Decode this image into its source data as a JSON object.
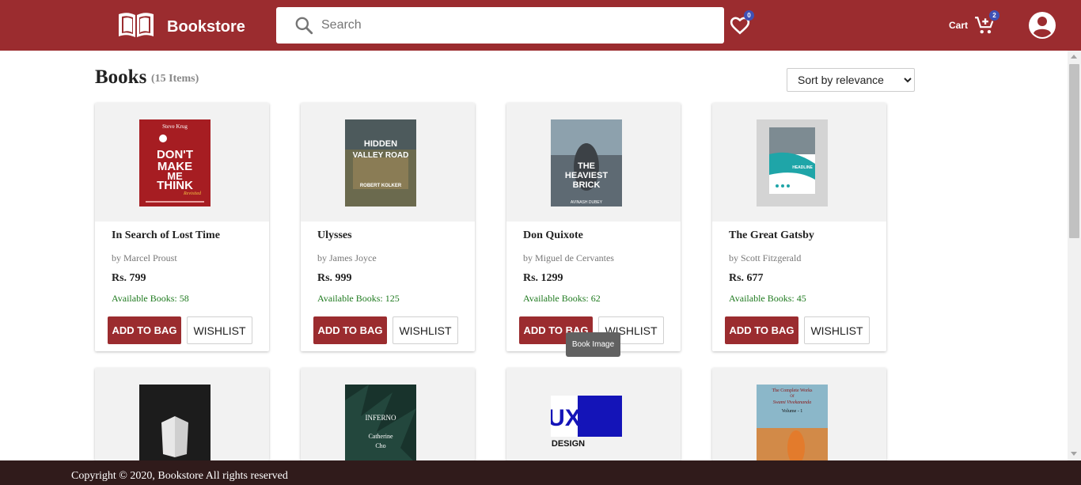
{
  "header": {
    "brand": "Bookstore",
    "search_placeholder": "Search",
    "wishlist_count": "0",
    "cart_label": "Cart",
    "cart_count": "2",
    "colors": {
      "primary": "#9b2c2f",
      "badge": "#3f51b5"
    }
  },
  "main": {
    "title": "Books",
    "count": "(15  Items)",
    "sort": {
      "selected": "Sort by relevance"
    }
  },
  "books": [
    {
      "title": "In Search of Lost Time",
      "author": "by Marcel Proust",
      "price": "Rs. 799",
      "available": "Available Books: 58",
      "cover": "book-cover-dont-make-me-think",
      "cover_lines": [
        "Steve Krug",
        "DON'T",
        "MAKE",
        "ME",
        "THINK",
        "Revisited"
      ]
    },
    {
      "title": "Ulysses",
      "author": "by James Joyce",
      "price": "Rs. 999",
      "available": "Available Books: 125",
      "cover": "book-cover-hidden-valley-road",
      "cover_lines": [
        "HIDDEN",
        "VALLEY ROAD",
        "ROBERT KOLKER"
      ]
    },
    {
      "title": "Don Quixote",
      "author": "by Miguel de Cervantes",
      "price": "Rs. 1299",
      "available": "Available Books: 62",
      "cover": "book-cover-heaviest-brick",
      "cover_lines": [
        "THE",
        "HEAVIEST",
        "BRICK",
        "AVINASH DUBEY"
      ]
    },
    {
      "title": "The Great Gatsby",
      "author": "by Scott Fitzgerald",
      "price": "Rs. 677",
      "available": "Available Books: 45",
      "cover": "book-cover-headline",
      "cover_lines": [
        "HEADLINE"
      ]
    },
    {
      "cover": "book-cover-open-book"
    },
    {
      "cover": "book-cover-inferno",
      "cover_lines": [
        "INFERNO",
        "Catherine",
        "Cho"
      ]
    },
    {
      "cover": "book-cover-ux-design",
      "cover_lines": [
        "UX",
        "DESIGN"
      ]
    },
    {
      "cover": "book-cover-swami-vivekananda",
      "cover_lines": [
        "The Complete Works",
        "Of",
        "Swami Vivekananda",
        "Volume - 1"
      ]
    }
  ],
  "buttons": {
    "add_to_bag": "ADD TO BAG",
    "wishlist": "WISHLIST"
  },
  "tooltip": "Book Image",
  "footer": {
    "text": "Copyright © 2020, Bookstore All rights reserved"
  }
}
